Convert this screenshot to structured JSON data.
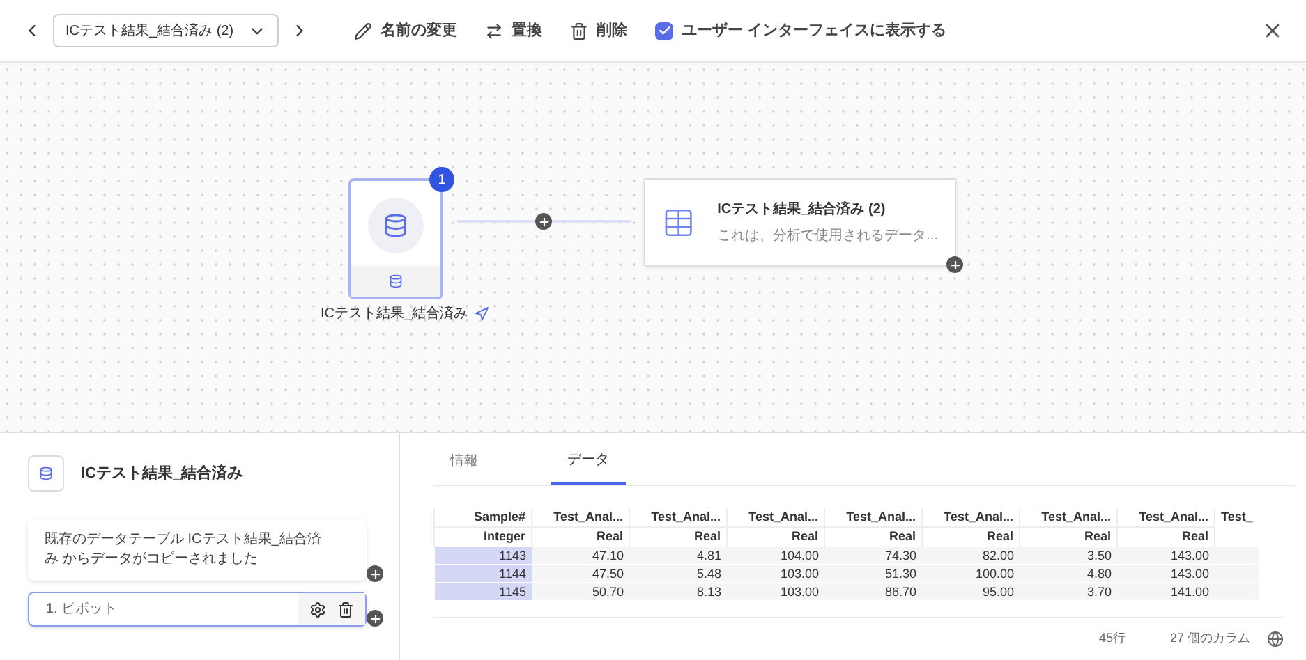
{
  "toolbar": {
    "dataset_select": "ICテスト結果_結合済み (2)",
    "actions": [
      {
        "kind": "rename",
        "label": "名前の変更"
      },
      {
        "kind": "replace",
        "label": "置換"
      },
      {
        "kind": "delete",
        "label": "削除"
      }
    ],
    "show_in_ui": {
      "label": "ユーザー インターフェイスに表示する",
      "checked": true
    }
  },
  "canvas": {
    "source": {
      "label": "ICテスト結果_結合済み",
      "badge": "1"
    },
    "output": {
      "title": "ICテスト結果_結合済み (2)",
      "description": "これは、分析で使用されるデータ..."
    }
  },
  "left_panel": {
    "title": "ICテスト結果_結合済み",
    "note": "既存のデータテーブル ICテスト結果_結合済み からデータがコピーされました",
    "steps": [
      {
        "label": "1. ピボット",
        "selected": true
      }
    ]
  },
  "tabs": [
    {
      "label": "情報",
      "selected": false
    },
    {
      "label": "データ",
      "selected": true
    }
  ],
  "table": {
    "columns": [
      {
        "name": "Sample#",
        "type": "Integer"
      },
      {
        "name": "Test_Anal...",
        "type": "Real"
      },
      {
        "name": "Test_Anal...",
        "type": "Real"
      },
      {
        "name": "Test_Anal...",
        "type": "Real"
      },
      {
        "name": "Test_Anal...",
        "type": "Real"
      },
      {
        "name": "Test_Anal...",
        "type": "Real"
      },
      {
        "name": "Test_Anal...",
        "type": "Real"
      },
      {
        "name": "Test_Anal...",
        "type": "Real"
      },
      {
        "name": "Test_"
      }
    ],
    "rows": [
      [
        "1143",
        "47.10",
        "4.81",
        "104.00",
        "74.30",
        "82.00",
        "3.50",
        "143.00"
      ],
      [
        "1144",
        "47.50",
        "5.48",
        "103.00",
        "51.30",
        "100.00",
        "4.80",
        "143.00"
      ],
      [
        "1145",
        "50.70",
        "8.13",
        "103.00",
        "86.70",
        "95.00",
        "3.70",
        "141.00"
      ]
    ]
  },
  "footer": {
    "row_count": "45行",
    "column_count": "27 個のカラム"
  }
}
